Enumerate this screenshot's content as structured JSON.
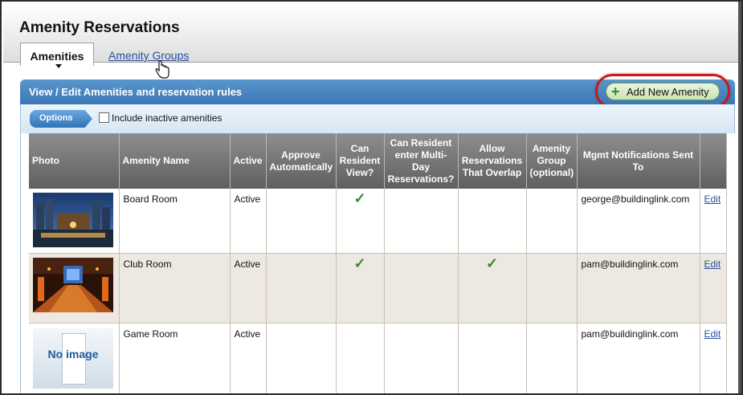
{
  "page": {
    "title": "Amenity Reservations"
  },
  "tabs": {
    "active": "Amenities",
    "link": "Amenity Groups"
  },
  "panel": {
    "title": "View / Edit Amenities and reservation rules",
    "add_button_label": "Add New Amenity"
  },
  "options": {
    "button_label": "Options",
    "inactive_checkbox_label": "Include inactive amenities",
    "inactive_checked": false
  },
  "table": {
    "headers": [
      "Photo",
      "Amenity Name",
      "Active",
      "Approve Automatically",
      "Can Resident View?",
      "Can Resident enter Multi-Day Reservations?",
      "Allow Reservations That Overlap",
      "Amenity Group (optional)",
      "Mgmt Notifications Sent To",
      ""
    ],
    "rows": [
      {
        "photo": "board-room-photo",
        "name": "Board Room",
        "active": "Active",
        "approve_auto": false,
        "resident_view": true,
        "multi_day": false,
        "overlap": false,
        "group": "",
        "notify": "george@buildinglink.com",
        "edit": "Edit"
      },
      {
        "photo": "club-room-photo",
        "name": "Club Room",
        "active": "Active",
        "approve_auto": false,
        "resident_view": true,
        "multi_day": false,
        "overlap": true,
        "group": "",
        "notify": "pam@buildinglink.com",
        "edit": "Edit"
      },
      {
        "photo": "no-image-placeholder",
        "photo_text": "No image",
        "name": "Game Room",
        "active": "Active",
        "approve_auto": false,
        "resident_view": false,
        "multi_day": false,
        "overlap": false,
        "group": "",
        "notify": "pam@buildinglink.com",
        "edit": "Edit"
      }
    ]
  },
  "icons": {
    "checkmark": "checkmark-icon",
    "plus": "plus-icon",
    "cursor": "hand-cursor-icon"
  },
  "colors": {
    "panel_blue": "#3a78b6",
    "link_blue": "#2a4e9c",
    "check_green": "#2e8b2e",
    "highlight_red": "#c81a1a",
    "header_gray": "#6e6e6e"
  }
}
